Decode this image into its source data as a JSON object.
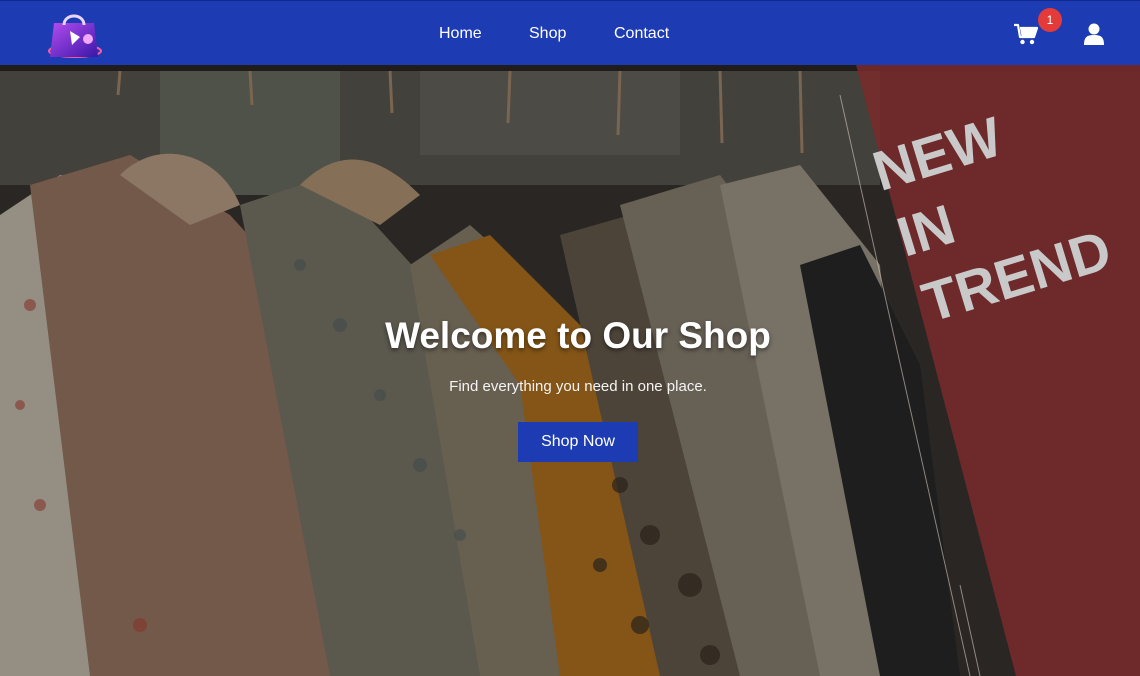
{
  "nav": {
    "links": [
      "Home",
      "Shop",
      "Contact"
    ],
    "cart_count": "1"
  },
  "hero": {
    "title": "Welcome to Our Shop",
    "subtitle": "Find everything you need in one place.",
    "button": "Shop Now",
    "promo": [
      "NEW",
      "IN",
      "TREND"
    ]
  },
  "colors": {
    "nav_bg": "#1d3bb3",
    "badge": "#e33a3a",
    "promo_band": "#7a2a2c"
  },
  "icons": [
    "shopping-bag-logo-icon",
    "cart-icon",
    "user-icon"
  ]
}
